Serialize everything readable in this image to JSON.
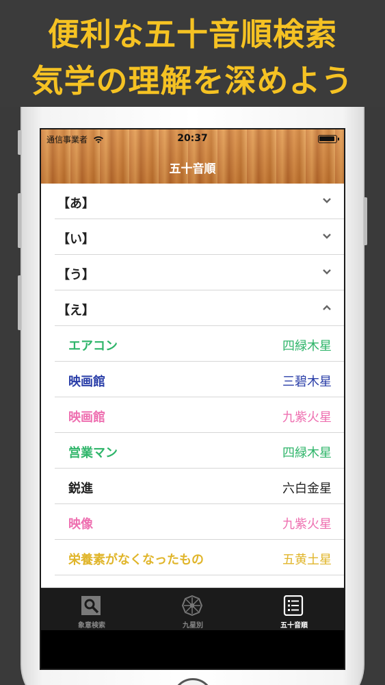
{
  "banner": {
    "line1": "便利な五十音順検索",
    "line2": "気学の理解を深めよう"
  },
  "status_bar": {
    "carrier": "通信事業者",
    "time": "20:37"
  },
  "nav": {
    "title": "五十音順"
  },
  "sections": [
    {
      "label": "【あ】",
      "expanded": false
    },
    {
      "label": "【い】",
      "expanded": false
    },
    {
      "label": "【う】",
      "expanded": false
    },
    {
      "label": "【え】",
      "expanded": true
    }
  ],
  "items": [
    {
      "name": "エアコン",
      "star": "四緑木星",
      "color": "#2fb56a"
    },
    {
      "name": "映画館",
      "star": "三碧木星",
      "color": "#2a3ea8"
    },
    {
      "name": "映画館",
      "star": "九紫火星",
      "color": "#ee6fb0"
    },
    {
      "name": "営業マン",
      "star": "四緑木星",
      "color": "#2fb56a"
    },
    {
      "name": "鋭進",
      "star": "六白金星",
      "color": "#222222"
    },
    {
      "name": "映像",
      "star": "九紫火星",
      "color": "#ee6fb0"
    },
    {
      "name": "栄養素がなくなったもの",
      "star": "五黄土星",
      "color": "#e0b52a"
    }
  ],
  "tabs": [
    {
      "label": "象意検索",
      "icon": "search-icon",
      "active": false
    },
    {
      "label": "九星別",
      "icon": "compass-wheel-icon",
      "active": false
    },
    {
      "label": "五十音順",
      "icon": "list-icon",
      "active": true
    }
  ],
  "colors": {
    "banner_text": "#f5c223",
    "banner_bg": "#3b3b3b",
    "nav_wood": "#d08845",
    "tab_bg": "#1b1b1b"
  }
}
